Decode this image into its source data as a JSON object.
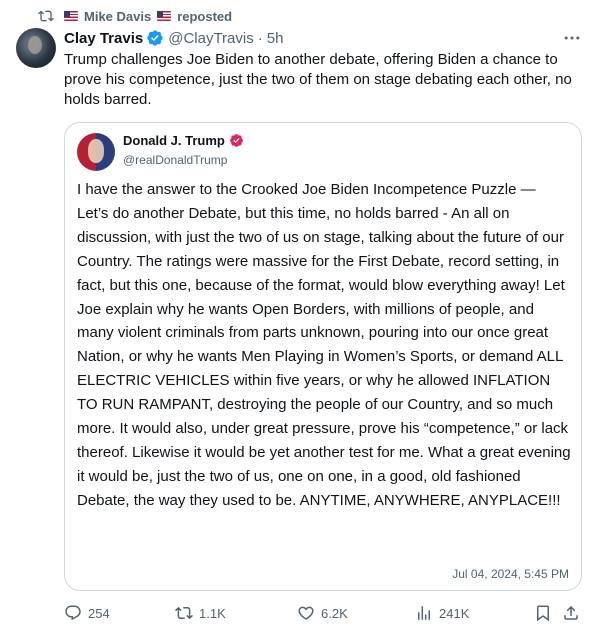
{
  "repost": {
    "text": "reposted",
    "user": "Mike Davis"
  },
  "tweet": {
    "author_name": "Clay Travis",
    "author_handle": "@ClayTravis",
    "separator": "·",
    "time": "5h",
    "text": "Trump challenges Joe Biden to another debate, offering Biden a chance to prove his competence, just the two of them on stage debating each other, no holds barred."
  },
  "quote": {
    "author_name": "Donald J. Trump",
    "author_handle": "@realDonaldTrump",
    "text": "I have the answer to the Crooked Joe Biden Incompetence Puzzle — Let’s do another Debate, but this time, no holds barred - An all on discussion, with just the two of us on stage, talking about the future of our Country. The ratings were massive for the First Debate, record setting, in fact, but this one, because of the format, would blow everything away! Let Joe explain why he wants Open Borders, with millions of people, and many violent criminals from parts unknown, pouring into our once great Nation, or why he wants Men Playing in Women’s Sports, or demand ALL ELECTRIC VEHICLES within five years, or why he allowed INFLATION TO RUN RAMPANT, destroying the people of our Country, and so much more. It would also, under great pressure, prove his “competence,” or lack thereof. Likewise it would be yet another test for me. What a great evening it would be, just the two of us, one on one, in a good, old fashioned Debate, the way they used to be. ANYTIME, ANYWHERE, ANYPLACE!!!",
    "date": "Jul 04, 2024, 5:45 PM"
  },
  "actions": {
    "replies": "254",
    "reposts": "1.1K",
    "likes": "6.2K",
    "views": "241K"
  },
  "icons": [
    "retweet-icon",
    "verified-icon",
    "more-icon",
    "pink-verified-icon",
    "reply-icon",
    "retweet-icon",
    "like-icon",
    "views-icon",
    "bookmark-icon",
    "share-icon"
  ],
  "colors": {
    "verified_blue": "#1d9bf0",
    "muted": "#536471",
    "pink_badge": "#e0245e"
  }
}
